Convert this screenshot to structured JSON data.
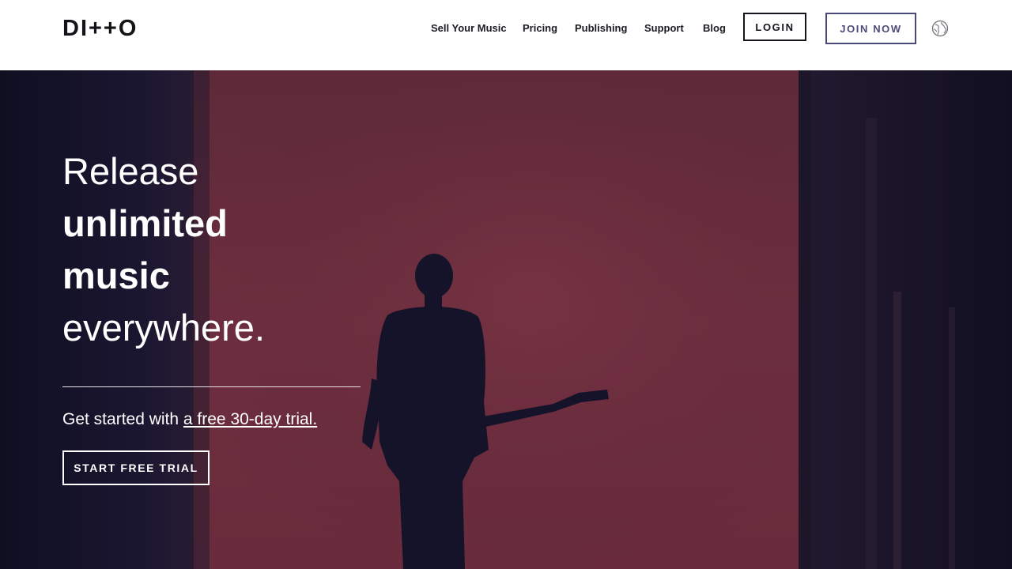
{
  "header": {
    "logo": "DI++O",
    "nav": [
      {
        "label": "Sell Your Music"
      },
      {
        "label": "Pricing"
      },
      {
        "label": "Publishing"
      },
      {
        "label": "Support"
      },
      {
        "label": "Blog"
      }
    ],
    "login_label": "LOGIN",
    "join_label": "JOIN NOW",
    "language_icon": "globe-icon"
  },
  "hero": {
    "headline_line1": "Release",
    "headline_line2": "unlimited",
    "headline_line3": "music",
    "headline_line4": "everywhere.",
    "subline_prefix": "Get started with ",
    "subline_link": "a free 30-day trial.",
    "cta_label": "START FREE TRIAL",
    "background_image": "silhouette of guitarist against red-lit stage wall"
  },
  "colors": {
    "brand_dark": "#15151c",
    "join_accent": "#4a4a78",
    "hero_red": "#6b2d3d",
    "hero_dark": "#15142a"
  }
}
